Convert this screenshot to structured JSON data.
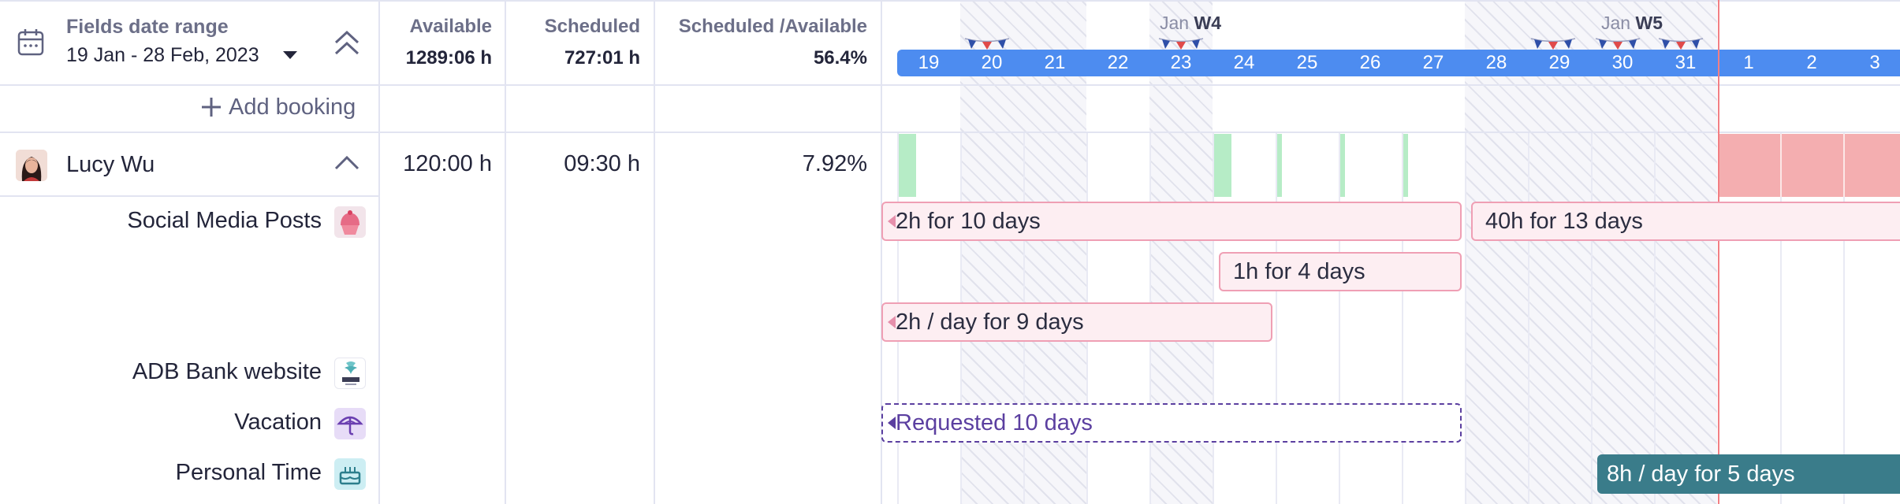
{
  "filter": {
    "title": "Fields date range",
    "range": "19 Jan - 28 Feb, 2023",
    "calendar_icon": "calendar-icon",
    "dropdown_icon": "caret-down-icon",
    "collapse_icon": "double-chevron-up-icon"
  },
  "summary": {
    "available_label": "Available",
    "available_value": "1289:06 h",
    "scheduled_label": "Scheduled",
    "scheduled_value": "727:01 h",
    "ratio_label": "Scheduled /Available",
    "ratio_value": "56.4%"
  },
  "add_booking": {
    "label": "Add booking",
    "icon": "plus-icon"
  },
  "timeline": {
    "weeks": [
      {
        "month": "Jan",
        "week": "W4"
      },
      {
        "month": "Jan",
        "week": "W5"
      }
    ],
    "days": [
      "19",
      "20",
      "21",
      "22",
      "23",
      "24",
      "25",
      "26",
      "27",
      "28",
      "29",
      "30",
      "31",
      "1",
      "2",
      "3"
    ],
    "colors": {
      "day_band": "#4d8cf0",
      "available": "#b6ecc6",
      "overbooked": "#f4aeb0",
      "booking_fill": "#fdeef2",
      "requested": "#5b3fa0",
      "teal_booking": "#3a7c8a"
    }
  },
  "person": {
    "name": "Lucy Wu",
    "available": "120:00 h",
    "scheduled": "09:30 h",
    "ratio": "7.92%",
    "collapse_icon": "chevron-up-icon"
  },
  "projects": [
    {
      "name": "Social Media Posts",
      "icon": "cupcake-icon"
    },
    {
      "name": "ADB Bank website",
      "icon": "adb-logo-icon"
    },
    {
      "name": "Vacation",
      "icon": "umbrella-icon"
    },
    {
      "name": "Personal Time",
      "icon": "cake-icon"
    }
  ],
  "bookings": [
    {
      "label": "2h for 10 days"
    },
    {
      "label": "40h for 13 days"
    },
    {
      "label": "1h for 4 days"
    },
    {
      "label": "2h / day for 9 days"
    },
    {
      "label": "Requested 10 days"
    },
    {
      "label": "8h / day for 5 days"
    }
  ]
}
